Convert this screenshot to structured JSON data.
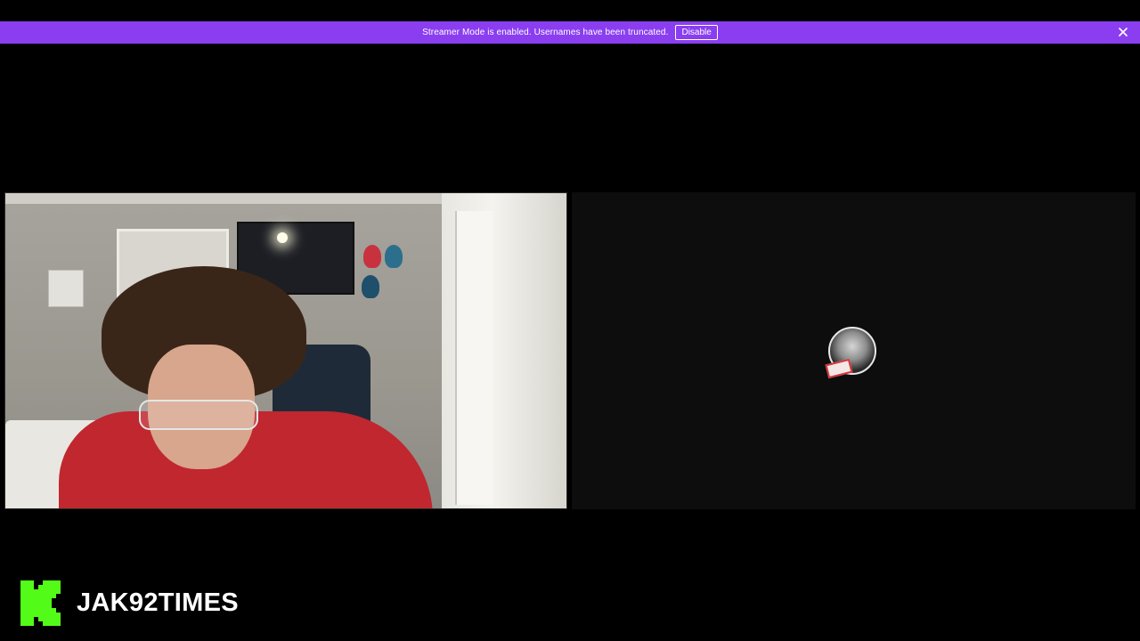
{
  "banner": {
    "message": "Streamer Mode is enabled. Usernames have been truncated.",
    "disable_label": "Disable",
    "background_color": "#8a3ef0",
    "close_icon": "close-icon"
  },
  "streams": {
    "left": {
      "type": "webcam-feed"
    },
    "right": {
      "type": "avatar-placeholder",
      "avatar_icon": "user-avatar"
    }
  },
  "brand": {
    "logo_icon": "kick-logo-icon",
    "logo_color": "#53fc18",
    "channel_name": "JAK92TIMES"
  }
}
